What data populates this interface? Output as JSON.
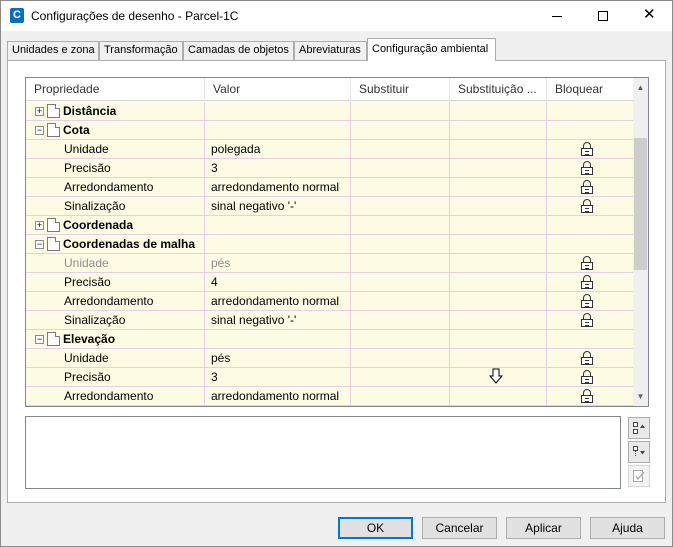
{
  "window": {
    "title": "Configurações de desenho - Parcel-1C",
    "app_icon_letter": "C"
  },
  "tabs": [
    {
      "label": "Unidades e zona",
      "active": false
    },
    {
      "label": "Transformação",
      "active": false
    },
    {
      "label": "Camadas de objetos",
      "active": false
    },
    {
      "label": "Abreviaturas",
      "active": false
    },
    {
      "label": "Configuração ambiental",
      "active": true
    }
  ],
  "grid": {
    "columns": [
      "Propriedade",
      "Valor",
      "Substituir",
      "Substituição ...",
      "Bloquear"
    ],
    "rows": [
      {
        "type": "group",
        "expanded": false,
        "label": "Distância",
        "value": "",
        "lock": false
      },
      {
        "type": "group",
        "expanded": true,
        "label": "Cota",
        "value": "",
        "lock": false
      },
      {
        "type": "item",
        "label": "Unidade",
        "value": "polegada",
        "lock": true,
        "disabled": false
      },
      {
        "type": "item",
        "label": "Precisão",
        "value": "3",
        "lock": true,
        "disabled": false
      },
      {
        "type": "item",
        "label": "Arredondamento",
        "value": "arredondamento normal",
        "lock": true,
        "disabled": false
      },
      {
        "type": "item",
        "label": "Sinalização",
        "value": "sinal negativo '-'",
        "lock": true,
        "disabled": false
      },
      {
        "type": "group",
        "expanded": false,
        "label": "Coordenada",
        "value": "",
        "lock": false
      },
      {
        "type": "group",
        "expanded": true,
        "label": "Coordenadas de malha",
        "value": "",
        "lock": false
      },
      {
        "type": "item",
        "label": "Unidade",
        "value": "pés",
        "lock": true,
        "disabled": true
      },
      {
        "type": "item",
        "label": "Precisão",
        "value": "4",
        "lock": true,
        "disabled": false
      },
      {
        "type": "item",
        "label": "Arredondamento",
        "value": "arredondamento normal",
        "lock": true,
        "disabled": false
      },
      {
        "type": "item",
        "label": "Sinalização",
        "value": "sinal negativo '-'",
        "lock": true,
        "disabled": false
      },
      {
        "type": "group",
        "expanded": true,
        "label": "Elevação",
        "value": "",
        "lock": false
      },
      {
        "type": "item",
        "label": "Unidade",
        "value": "pés",
        "lock": true,
        "disabled": false
      },
      {
        "type": "item",
        "label": "Precisão",
        "value": "3",
        "lock": true,
        "disabled": false
      },
      {
        "type": "item",
        "label": "Arredondamento",
        "value": "arredondamento normal",
        "lock": true,
        "disabled": false
      },
      {
        "type": "item",
        "label": "",
        "value": "",
        "lock": true,
        "disabled": false
      }
    ]
  },
  "buttons": {
    "ok": "OK",
    "cancel": "Cancelar",
    "apply": "Aplicar",
    "help": "Ajuda"
  },
  "colors": {
    "row_background": "#fdfbe4",
    "row_border": "#e3cfe6",
    "accent": "#0078d7"
  }
}
